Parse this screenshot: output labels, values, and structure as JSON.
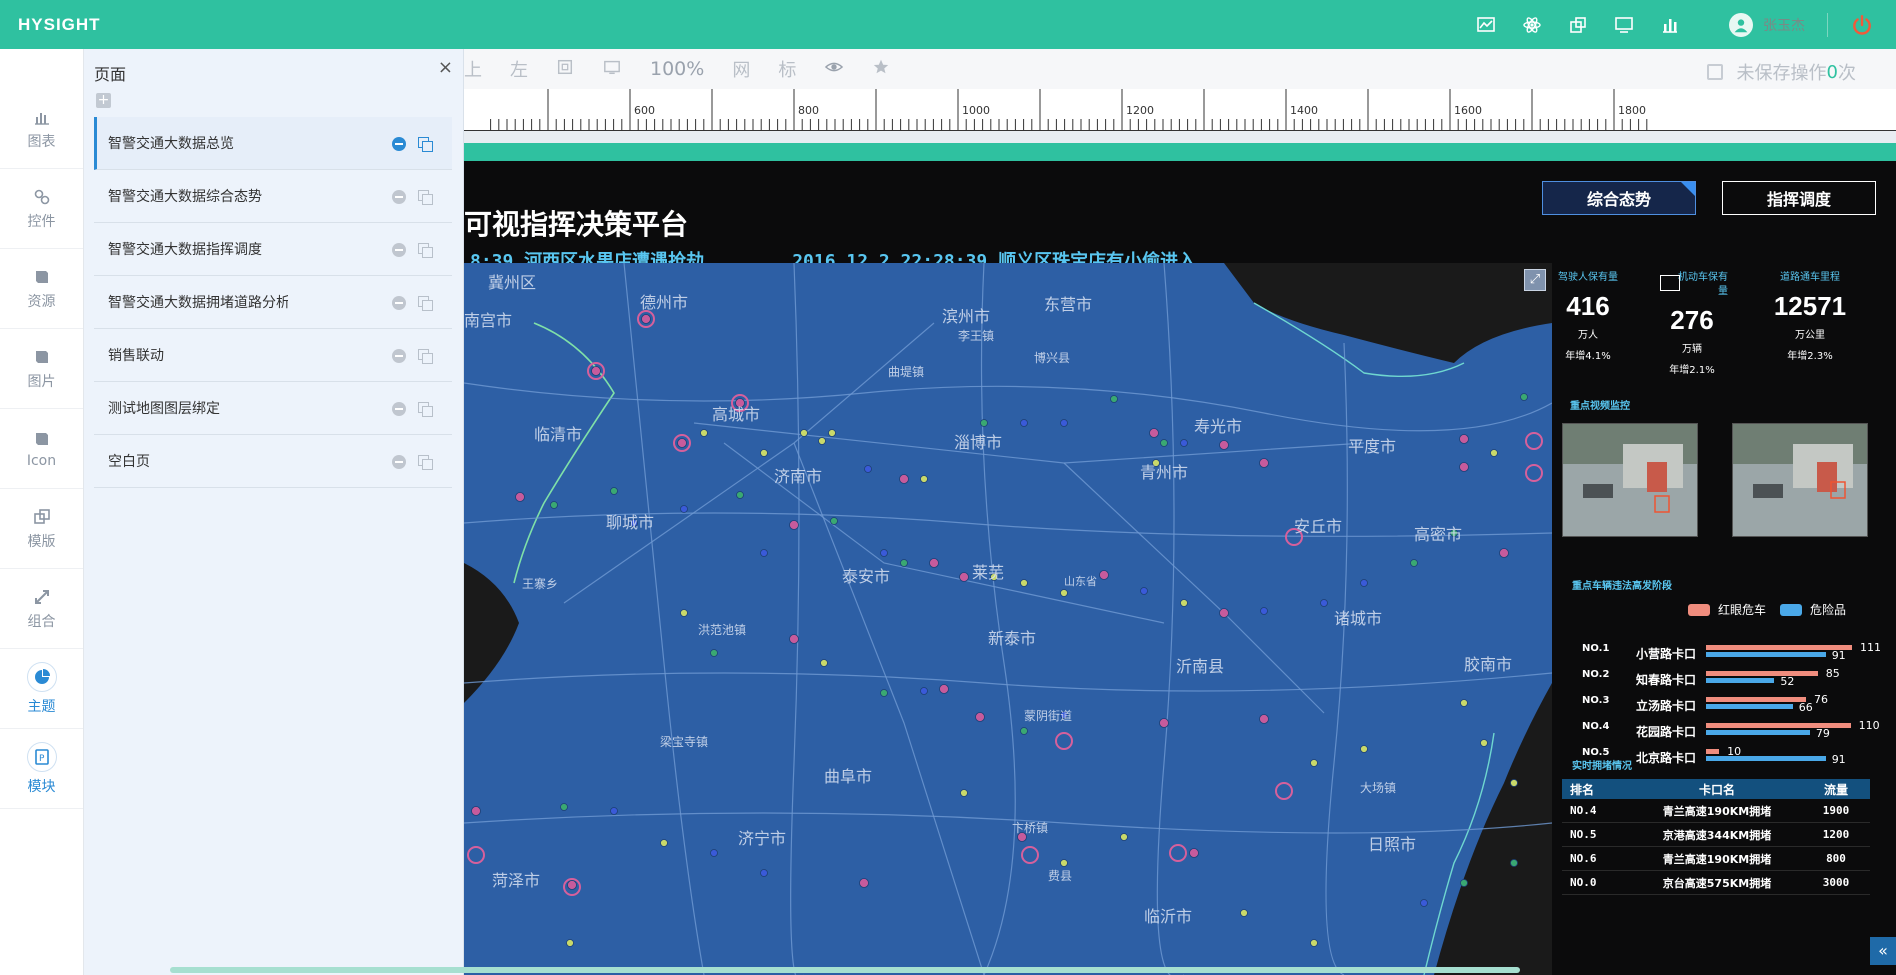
{
  "app": {
    "brand": "HYSIGHT",
    "user_name": "张玉杰"
  },
  "top_icons": [
    "chart-icon",
    "atom-icon",
    "puzzle-icon",
    "monitor-icon",
    "bar-chart-icon"
  ],
  "sidebar": {
    "items": [
      {
        "label": "图表",
        "icon": "bar-chart-icon"
      },
      {
        "label": "控件",
        "icon": "link-icon"
      },
      {
        "label": "资源",
        "icon": "book-icon"
      },
      {
        "label": "图片",
        "icon": "book-icon"
      },
      {
        "label": "Icon",
        "icon": "book-icon"
      },
      {
        "label": "模版",
        "icon": "template-icon"
      },
      {
        "label": "组合",
        "icon": "combine-icon"
      },
      {
        "label": "主题",
        "icon": "pie-icon",
        "active": true
      },
      {
        "label": "模块",
        "icon": "module-icon",
        "active": true
      }
    ]
  },
  "page_panel": {
    "title": "页面",
    "close": "×",
    "add": "+",
    "pages": [
      {
        "name": "智警交通大数据总览",
        "active": true
      },
      {
        "name": "智警交通大数据综合态势"
      },
      {
        "name": "智警交通大数据指挥调度"
      },
      {
        "name": "智警交通大数据拥堵道路分析"
      },
      {
        "name": "销售联动"
      },
      {
        "name": "测试地图图层绑定"
      },
      {
        "name": "空白页"
      }
    ]
  },
  "toolbar": {
    "items": [
      "上",
      "左"
    ],
    "zoom": "100%",
    "grid": "网",
    "mark": "标",
    "unsaved_label": "未保存操作",
    "unsaved_count": "0",
    "unsaved_suffix": "次"
  },
  "ruler": {
    "labels": [
      "600",
      "800",
      "1000",
      "1200",
      "1400",
      "1600",
      "1800"
    ]
  },
  "dashboard": {
    "title": "可视指挥决策平台",
    "ticker1": "8:39  河西区水果店遭遇抢劫",
    "ticker2": "2016.12.2  22:28:39  顺义区珠宝店有小偷进入",
    "tabs": [
      {
        "label": "综合态势",
        "active": true
      },
      {
        "label": "指挥调度"
      }
    ],
    "map_labels": [
      "冀州区",
      "南宫市",
      "德州市",
      "滨州市",
      "东营市",
      "临清市",
      "高城市",
      "济南市",
      "淄博市",
      "青州市",
      "寿光市",
      "平度市",
      "聊城市",
      "泰安市",
      "莱芜",
      "安丘市",
      "高密市",
      "新泰市",
      "沂南县",
      "诸城市",
      "曲阜市",
      "济宁市",
      "菏泽市",
      "临沂市",
      "日照市",
      "山东省",
      "王寨乡",
      "洪范池镇",
      "梁宝寺镇",
      "蒙阴街道",
      "卞桥镇",
      "费县",
      "博兴县",
      "李王镇",
      "曲堤镇",
      "大场镇",
      "胶南市"
    ],
    "stats": [
      {
        "cap": "驾驶人保有量",
        "value": "416",
        "unit": "万人",
        "yr": "年增4.1%"
      },
      {
        "cap": "机动车保有量",
        "value": "276",
        "unit": "万辆",
        "yr": "年增2.1%"
      },
      {
        "cap": "道路通车里程",
        "value": "12571",
        "unit": "万公里",
        "yr": "年增2.3%"
      }
    ],
    "video_title": "重点视频监控",
    "violation_title": "重点车辆违法高发阶段",
    "legend": [
      {
        "label": "红眼危车",
        "color": "#f08d7e"
      },
      {
        "label": "危险品",
        "color": "#4aa8e8"
      }
    ],
    "ranks": [
      {
        "no": "NO.1",
        "name": "小营路卡口",
        "red": 111,
        "blue": 91
      },
      {
        "no": "NO.2",
        "name": "知春路卡口",
        "red": 85,
        "blue": 52
      },
      {
        "no": "NO.3",
        "name": "立汤路卡口",
        "red": 76,
        "blue": 66
      },
      {
        "no": "NO.4",
        "name": "花园路卡口",
        "red": 110,
        "blue": 79
      },
      {
        "no": "NO.5",
        "name": "北京路卡口",
        "red": 10,
        "blue": 91
      }
    ],
    "congestion_title": "实时拥堵情况",
    "table": {
      "headers": [
        "排名",
        "卡口名",
        "流量"
      ],
      "rows": [
        [
          "NO.4",
          "青兰高速190KM拥堵",
          "1900"
        ],
        [
          "NO.5",
          "京港高速344KM拥堵",
          "1200"
        ],
        [
          "NO.6",
          "青兰高速190KM拥堵",
          "800"
        ],
        [
          "NO.0",
          "京台高速575KM拥堵",
          "3000"
        ]
      ]
    }
  },
  "colors": {
    "brand": "#2fc1a0",
    "map": "#2d5fa5",
    "accent": "#59c6f0"
  }
}
